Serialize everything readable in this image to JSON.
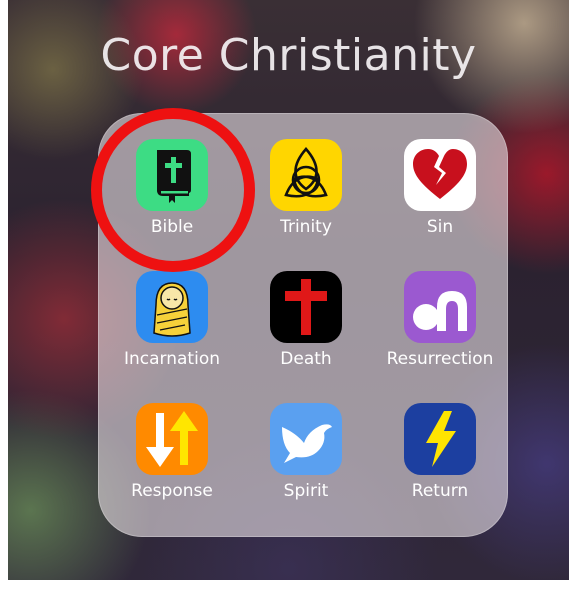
{
  "folder": {
    "title": "Core Christianity"
  },
  "apps": [
    {
      "label": "Bible",
      "icon": "bible-icon",
      "color": "#3ddc84"
    },
    {
      "label": "Trinity",
      "icon": "triquetra-icon",
      "color": "#ffd600"
    },
    {
      "label": "Sin",
      "icon": "broken-heart-icon",
      "color": "#ffffff"
    },
    {
      "label": "Incarnation",
      "icon": "swaddled-baby-icon",
      "color": "#2d8cf0"
    },
    {
      "label": "Death",
      "icon": "cross-icon",
      "color": "#000000"
    },
    {
      "label": "Resurrection",
      "icon": "empty-tomb-icon",
      "color": "#9b59d0"
    },
    {
      "label": "Response",
      "icon": "up-down-arrows-icon",
      "color": "#ff8a00"
    },
    {
      "label": "Spirit",
      "icon": "dove-icon",
      "color": "#5aa0f0"
    },
    {
      "label": "Return",
      "icon": "lightning-bolt-icon",
      "color": "#1c3fa0"
    }
  ],
  "highlight": {
    "target": "Bible",
    "color": "#ee1111"
  }
}
